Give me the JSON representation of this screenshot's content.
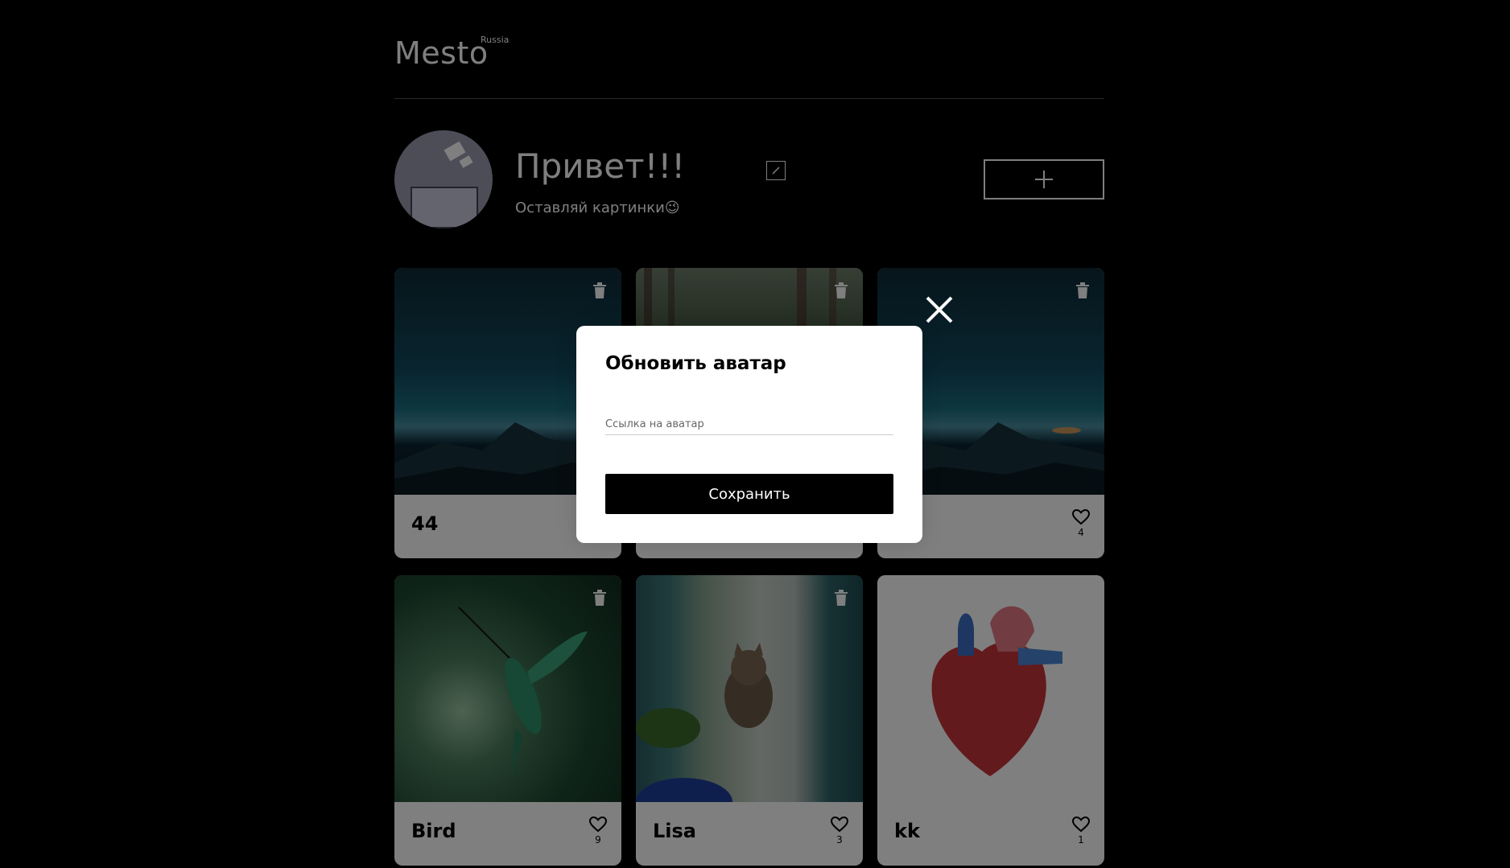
{
  "header": {
    "logo": "Mesto",
    "logo_sup": "Russia"
  },
  "profile": {
    "name": "Привет!!!",
    "about": "Оставляй картинки😉",
    "add_label": "+"
  },
  "cards": [
    {
      "title": "44",
      "likes": "",
      "image": "night-mountains"
    },
    {
      "title": "",
      "likes": "",
      "image": "forest-road"
    },
    {
      "title": "",
      "likes": "4",
      "image": "night-mountains"
    },
    {
      "title": "Bird",
      "likes": "9",
      "image": "hummingbird"
    },
    {
      "title": "Lisa",
      "likes": "3",
      "image": "cat-window"
    },
    {
      "title": "kk",
      "likes": "1",
      "image": "anatomical-heart"
    }
  ],
  "popup": {
    "title": "Обновить аватар",
    "input_placeholder": "Ссылка на аватар",
    "input_value": "",
    "save_label": "Сохранить"
  },
  "colors": {
    "background": "#000000",
    "overlay": "rgba(0,0,0,0.5)",
    "popup_bg": "#ffffff",
    "button_bg": "#000000"
  }
}
